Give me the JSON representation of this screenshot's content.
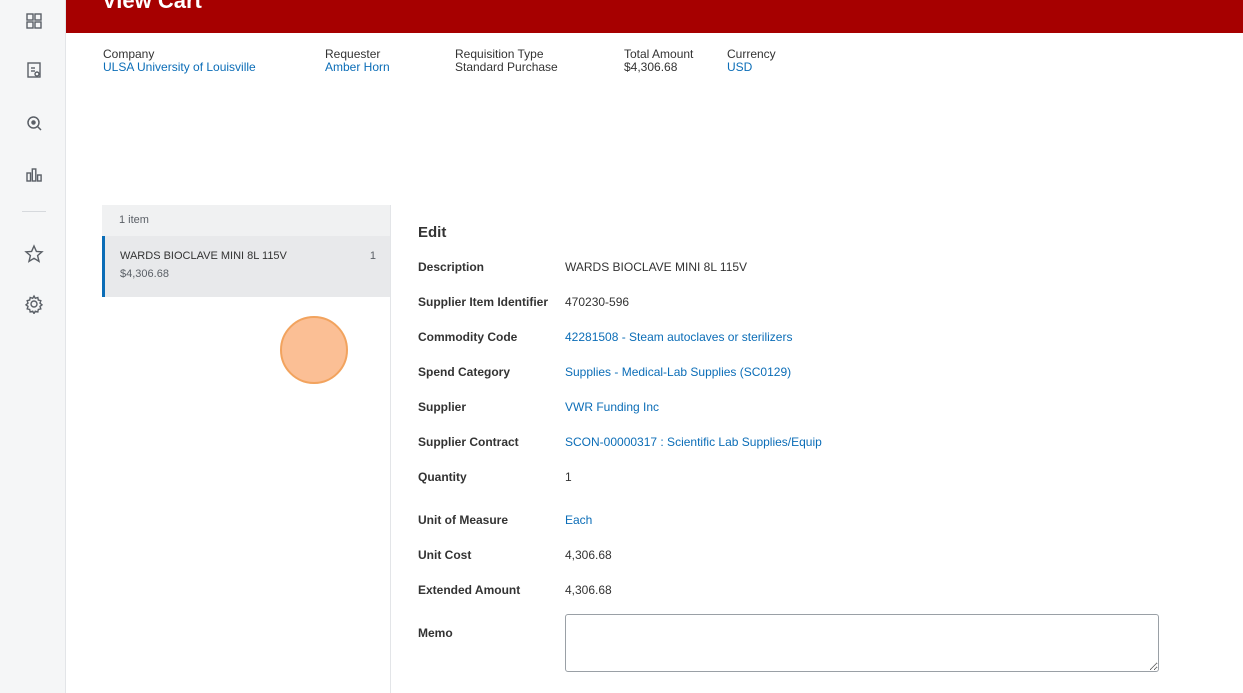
{
  "header": {
    "title": "View Cart",
    "fields": [
      {
        "label": "Company",
        "value": "ULSA University of Louisville",
        "link": true
      },
      {
        "label": "Requester",
        "value": "Amber Horn",
        "link": true
      },
      {
        "label": "Requisition Type",
        "value": "Standard Purchase",
        "link": false
      },
      {
        "label": "Total Amount",
        "value": "$4,306.68",
        "link": false
      },
      {
        "label": "Currency",
        "value": "USD",
        "link": true
      }
    ]
  },
  "rail": {
    "icons": [
      "apps-grid-icon",
      "worksheet-icon",
      "search-icon",
      "chart-icon",
      "star-icon",
      "gear-icon"
    ]
  },
  "items_panel": {
    "count_label": "1 item",
    "items": [
      {
        "name": "WARDS BIOCLAVE MINI 8L 115V",
        "qty": "1",
        "price": "$4,306.68"
      }
    ]
  },
  "edit": {
    "title": "Edit",
    "fields": {
      "description": {
        "label": "Description",
        "value": "WARDS BIOCLAVE MINI 8L 115V"
      },
      "supplier_item": {
        "label": "Supplier Item Identifier",
        "value": "470230-596"
      },
      "commodity_code": {
        "label": "Commodity Code",
        "value": "42281508 - Steam autoclaves or sterilizers"
      },
      "spend_category": {
        "label": "Spend Category",
        "value": "Supplies - Medical-Lab Supplies (SC0129)"
      },
      "supplier": {
        "label": "Supplier",
        "value": "VWR Funding Inc"
      },
      "supplier_contract": {
        "label": "Supplier Contract",
        "value": "SCON-00000317 : Scientific Lab Supplies/Equip"
      },
      "quantity": {
        "label": "Quantity",
        "value": "1"
      },
      "unit_of_measure": {
        "label": "Unit of Measure",
        "value": "Each"
      },
      "unit_cost": {
        "label": "Unit Cost",
        "value": "4,306.68"
      },
      "extended_amount": {
        "label": "Extended Amount",
        "value": "4,306.68"
      },
      "memo": {
        "label": "Memo",
        "value": ""
      }
    }
  },
  "colors": {
    "brand_red": "#a60000",
    "link_blue": "#0b6db7",
    "touch_orange": "#f2a35e"
  }
}
